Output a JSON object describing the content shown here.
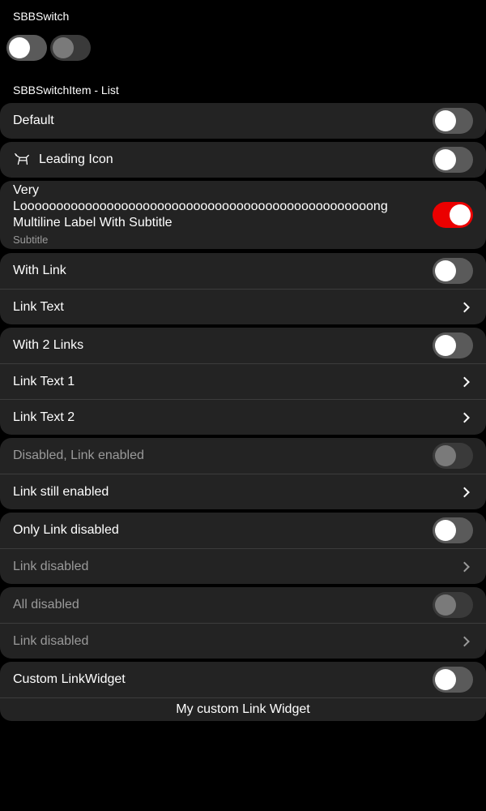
{
  "sections": {
    "switch_title": "SBBSwitch",
    "list_title": "SBBSwitchItem - List"
  },
  "standalone_switches": [
    {
      "state": "off"
    },
    {
      "state": "disabled"
    }
  ],
  "items": {
    "default": {
      "label": "Default",
      "state": "off"
    },
    "leading_icon": {
      "label": "Leading Icon",
      "state": "off",
      "icon": "dog-walking-icon"
    },
    "multiline": {
      "label": "Very Looooooooooooooooooooooooooooooooooooooooooooooooong Multiline Label With Subtitle",
      "subtitle": "Subtitle",
      "state": "on"
    },
    "with_link": {
      "label": "With Link",
      "state": "off",
      "link": "Link Text"
    },
    "with_2_links": {
      "label": "With 2 Links",
      "state": "off",
      "link1": "Link Text 1",
      "link2": "Link Text 2"
    },
    "disabled_link_enabled": {
      "label": "Disabled, Link enabled",
      "state": "disabled",
      "link": "Link still enabled"
    },
    "only_link_disabled": {
      "label": "Only Link disabled",
      "state": "off",
      "link": "Link disabled"
    },
    "all_disabled": {
      "label": "All disabled",
      "state": "disabled",
      "link": "Link disabled"
    },
    "custom_link": {
      "label": "Custom LinkWidget",
      "state": "off",
      "link_widget": "My custom Link Widget"
    }
  },
  "colors": {
    "background": "#000000",
    "surface": "#232323",
    "accent_on": "#eb0000",
    "toggle_off_track": "#5a5a5a",
    "muted_text": "#9a9a9a"
  }
}
